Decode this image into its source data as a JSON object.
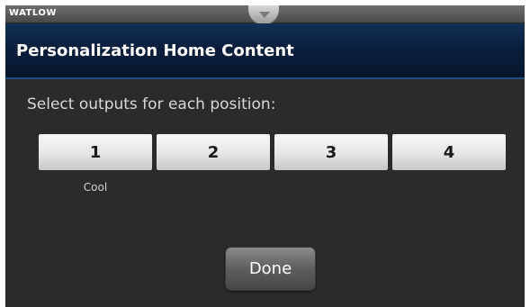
{
  "header": {
    "brand": "WATLOW",
    "title": "Personalization Home Content"
  },
  "main": {
    "prompt": "Select outputs for each position:",
    "positions": [
      {
        "label": "1",
        "assigned": "Cool"
      },
      {
        "label": "2",
        "assigned": ""
      },
      {
        "label": "3",
        "assigned": ""
      },
      {
        "label": "4",
        "assigned": ""
      }
    ]
  },
  "actions": {
    "done_label": "Done"
  },
  "colors": {
    "title_bar": "#0a1f3d",
    "background": "#2b2b2b",
    "button_face": "#e6e6e6"
  }
}
